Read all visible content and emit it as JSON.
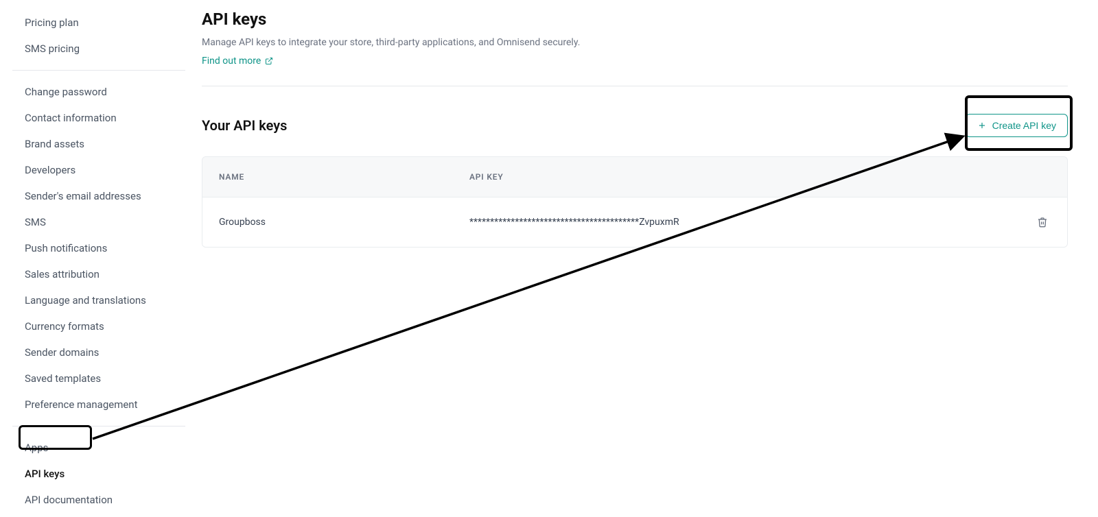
{
  "sidebar": {
    "groups": [
      {
        "items": [
          {
            "label": "Pricing plan",
            "key": "pricing-plan"
          },
          {
            "label": "SMS pricing",
            "key": "sms-pricing"
          }
        ]
      },
      {
        "items": [
          {
            "label": "Change password",
            "key": "change-password"
          },
          {
            "label": "Contact information",
            "key": "contact-information"
          },
          {
            "label": "Brand assets",
            "key": "brand-assets"
          },
          {
            "label": "Developers",
            "key": "developers"
          },
          {
            "label": "Sender's email addresses",
            "key": "senders-email-addresses"
          },
          {
            "label": "SMS",
            "key": "sms"
          },
          {
            "label": "Push notifications",
            "key": "push-notifications"
          },
          {
            "label": "Sales attribution",
            "key": "sales-attribution"
          },
          {
            "label": "Language and translations",
            "key": "language-and-translations"
          },
          {
            "label": "Currency formats",
            "key": "currency-formats"
          },
          {
            "label": "Sender domains",
            "key": "sender-domains"
          },
          {
            "label": "Saved templates",
            "key": "saved-templates"
          },
          {
            "label": "Preference management",
            "key": "preference-management"
          }
        ]
      },
      {
        "items": [
          {
            "label": "Apps",
            "key": "apps"
          },
          {
            "label": "API keys",
            "key": "api-keys",
            "active": true
          },
          {
            "label": "API documentation",
            "key": "api-documentation"
          }
        ]
      }
    ]
  },
  "main": {
    "title": "API keys",
    "subtitle": "Manage API keys to integrate your store, third-party applications, and Omnisend securely.",
    "learn_more_label": "Find out more",
    "section_title": "Your API keys",
    "create_button_label": "Create API key",
    "table": {
      "headers": {
        "name": "NAME",
        "key": "API KEY"
      },
      "rows": [
        {
          "name": "Groupboss",
          "key": "*****************************************ZvpuxmR"
        }
      ]
    }
  }
}
